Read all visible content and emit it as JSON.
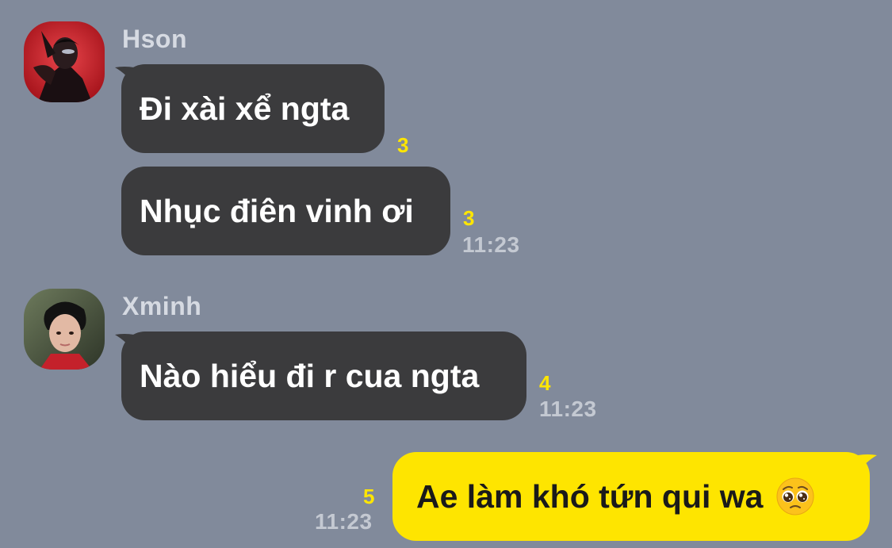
{
  "colors": {
    "background": "#818a9b",
    "incoming_bubble": "#3b3b3d",
    "outgoing_bubble": "#fee500",
    "read_count": "#ffe600",
    "timestamp": "#c4c9d2"
  },
  "messages": {
    "group1": {
      "sender": "Hson",
      "avatar_icon": "profile-photo-red-avatar-icon",
      "msg1": {
        "text": "Đi xài xể ngta",
        "unread": "3"
      },
      "msg2": {
        "text": "Nhục điên vinh ơi",
        "unread": "3",
        "time": "11:23"
      }
    },
    "group2": {
      "sender": "Xminh",
      "avatar_icon": "profile-photo-avatar-icon",
      "msg1": {
        "text": "Nào hiểu đi r cua ngta",
        "unread": "4",
        "time": "11:23"
      }
    },
    "outgoing": {
      "msg1": {
        "text": "Ae làm khó tứn qui wa",
        "emoji": "pleading-face-emoji-icon",
        "unread": "5",
        "time": "11:23"
      }
    }
  }
}
